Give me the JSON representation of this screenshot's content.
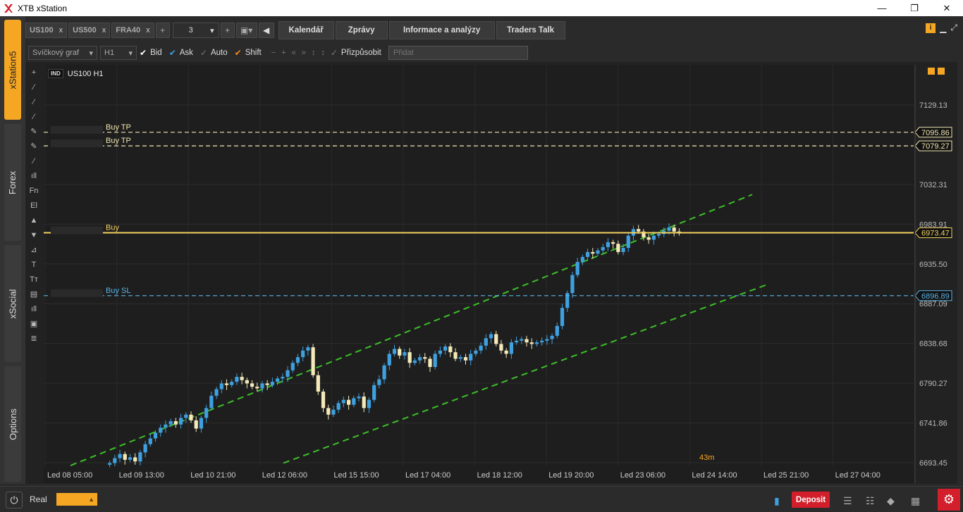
{
  "window": {
    "title": "XTB xStation",
    "controls": [
      "—",
      "❐",
      "✕"
    ]
  },
  "left_rail": {
    "tabs": [
      {
        "label": "xStation5",
        "active": true
      },
      {
        "label": "Forex",
        "active": false
      },
      {
        "label": "xSocial",
        "active": false
      },
      {
        "label": "Options",
        "active": false
      }
    ]
  },
  "top_bar": {
    "symbol_tabs": [
      {
        "label": "US100",
        "close": "x"
      },
      {
        "label": "US500",
        "close": "x"
      },
      {
        "label": "FRA40",
        "close": "x"
      }
    ],
    "add_tab": "+",
    "layout_count": "3",
    "layout_add": "+",
    "nav_tabs": [
      "Kalendář",
      "Zprávy",
      "Informace a analýzy",
      "Traders Talk"
    ]
  },
  "toolbar": {
    "chart_type": "Svíčkový graf",
    "timeframe": "H1",
    "checks": [
      {
        "label": "Bid",
        "state": "on"
      },
      {
        "label": "Ask",
        "state": "blue"
      },
      {
        "label": "Auto",
        "state": "off"
      },
      {
        "label": "Shift",
        "state": "orange"
      }
    ],
    "fit_label": "Přizpůsobit",
    "add_placeholder": "Přidat"
  },
  "draw_tools": [
    "+",
    "⁄",
    "⁄",
    "⁄",
    "✎",
    "✎",
    "⁄",
    "ıll",
    "Fn",
    "El",
    "▲",
    "▼",
    "⊿",
    "T",
    "Tт",
    "▤",
    "ıll",
    "▣",
    "≣"
  ],
  "chart": {
    "badge": "IND",
    "symbol_label": "US100 H1",
    "countdown": "43m",
    "orders": [
      {
        "label": "Buy  TP",
        "price": "7095.86"
      },
      {
        "label": "Buy  TP",
        "price": "7079.27"
      },
      {
        "label": "Buy",
        "price": "6973.47"
      },
      {
        "label": "Buy  SL",
        "price": "6896.89"
      }
    ]
  },
  "chart_data": {
    "type": "candlestick",
    "title": "US100 H1",
    "y_ticks": [
      "7129.13",
      "7032.31",
      "6983.91",
      "6935.50",
      "6887.09",
      "6838.68",
      "6790.27",
      "6741.86",
      "6693.45"
    ],
    "x_ticks": [
      "Led 08 05:00",
      "Led 09 13:00",
      "Led 10 21:00",
      "Led 12 06:00",
      "Led 15 15:00",
      "Led 17 04:00",
      "Led 18 12:00",
      "Led 19 20:00",
      "Led 23 06:00",
      "Led 24 14:00",
      "Led 25 21:00",
      "Led 27 04:00"
    ],
    "ylim": [
      6693.45,
      7129.13
    ],
    "price_lines": [
      {
        "label": "Buy TP",
        "value": 7095.86,
        "color": "#f0e6b0"
      },
      {
        "label": "Buy TP",
        "value": 7079.27,
        "color": "#f0e6b0"
      },
      {
        "label": "Buy",
        "value": 6973.47,
        "color": "#f0d060"
      },
      {
        "label": "Buy SL",
        "value": 6896.89,
        "color": "#5ab4e6"
      }
    ],
    "channel": {
      "upper": [
        [
          0,
          6690
        ],
        [
          1005,
          7020
        ]
      ],
      "lower": [
        [
          340,
          6693
        ],
        [
          1025,
          6910
        ]
      ]
    },
    "closes": [
      6693,
      6699,
      6704,
      6697,
      6700,
      6695,
      6706,
      6716,
      6723,
      6730,
      6736,
      6740,
      6744,
      6740,
      6748,
      6752,
      6745,
      6735,
      6748,
      6760,
      6775,
      6783,
      6790,
      6788,
      6792,
      6798,
      6794,
      6790,
      6786,
      6784,
      6790,
      6788,
      6792,
      6796,
      6798,
      6806,
      6815,
      6822,
      6830,
      6834,
      6800,
      6780,
      6760,
      6752,
      6758,
      6766,
      6770,
      6764,
      6772,
      6774,
      6760,
      6770,
      6788,
      6795,
      6812,
      6826,
      6832,
      6824,
      6828,
      6815,
      6818,
      6822,
      6820,
      6810,
      6826,
      6830,
      6835,
      6828,
      6820,
      6822,
      6818,
      6826,
      6830,
      6836,
      6845,
      6850,
      6838,
      6830,
      6826,
      6840,
      6842,
      6844,
      6840,
      6838,
      6840,
      6842,
      6844,
      6848,
      6860,
      6882,
      6900,
      6922,
      6938,
      6944,
      6950,
      6948,
      6952,
      6956,
      6962,
      6960,
      6950,
      6955,
      6970,
      6978,
      6975,
      6968,
      6965,
      6970,
      6972,
      6976,
      6980,
      6975,
      6973
    ]
  },
  "bottom_bar": {
    "account_label": "Real",
    "deposit_label": "Deposit"
  }
}
